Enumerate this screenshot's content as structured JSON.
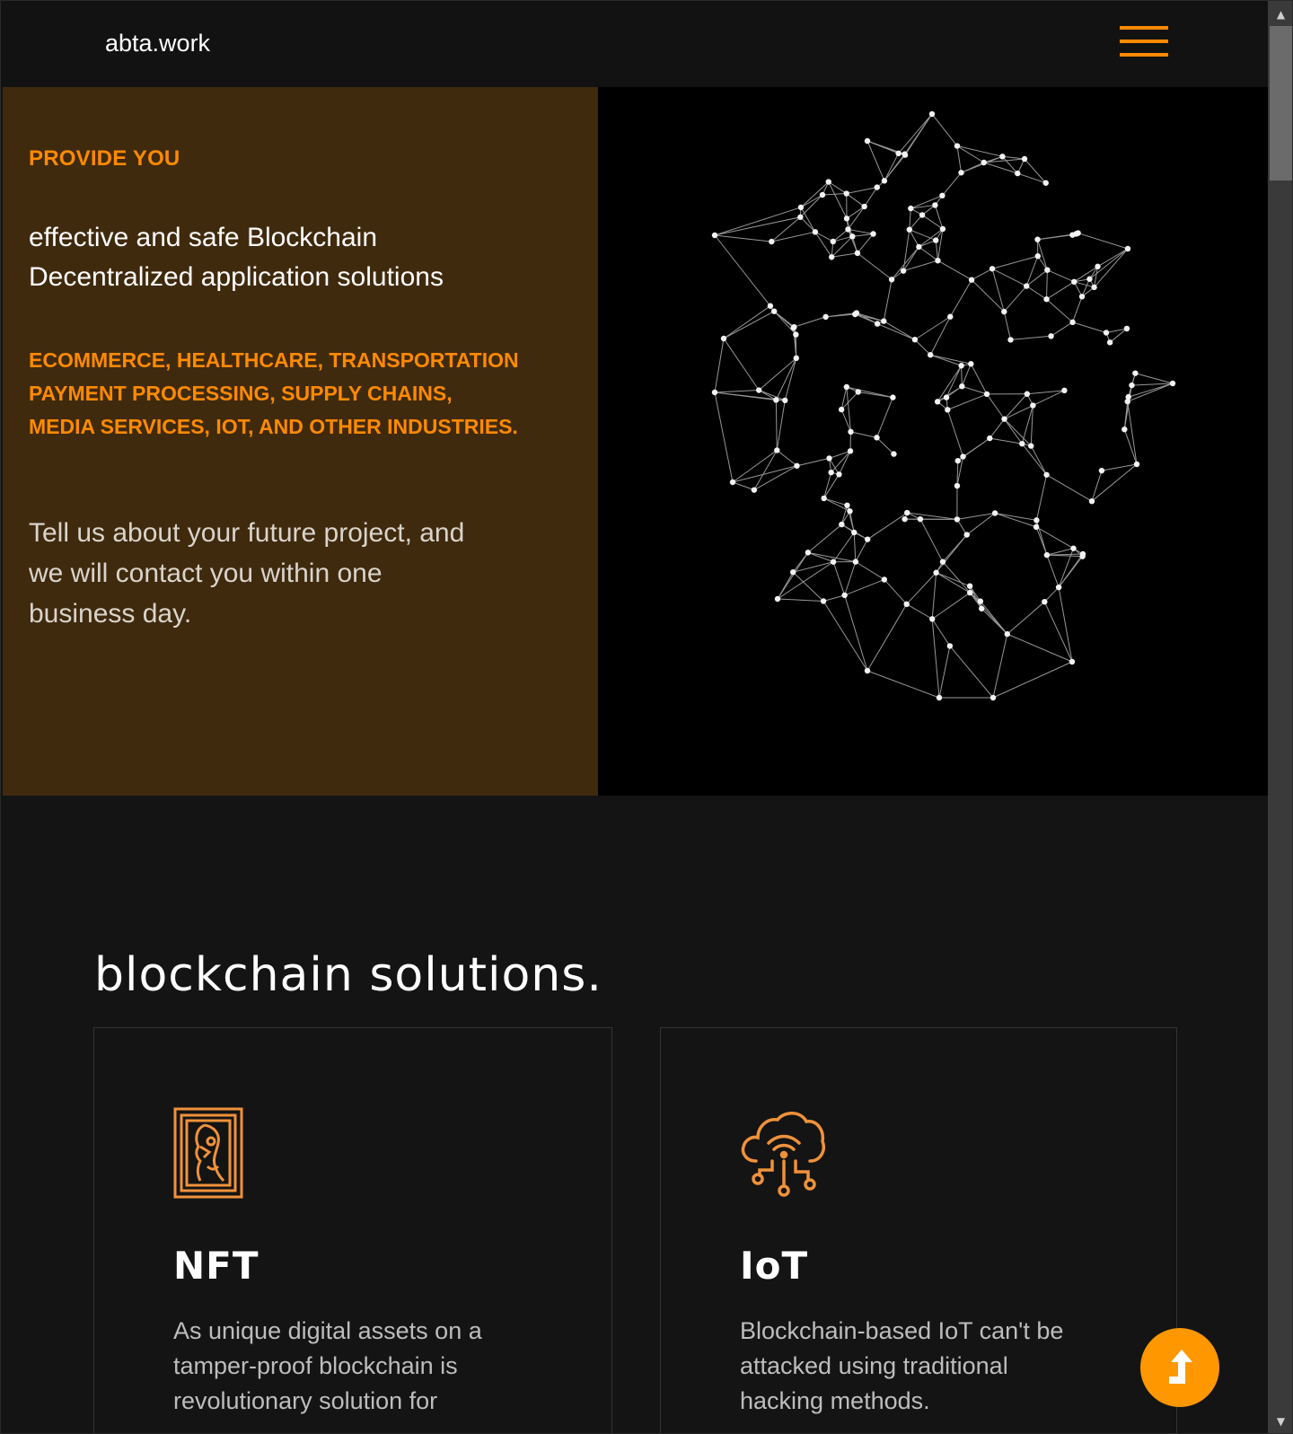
{
  "header": {
    "brand": "abta.work",
    "menu_icon": "hamburger-menu-icon",
    "accent": "#ff8a00"
  },
  "hero": {
    "eyebrow": "PROVIDE YOU",
    "heading_lines": [
      "effective and safe Blockchain",
      "Decentralized application solutions"
    ],
    "industries_lines": [
      "ECOMMERCE, HEALTHCARE, TRANSPORTATION",
      "PAYMENT PROCESSING, SUPPLY CHAINS,",
      "MEDIA SERVICES, IOT, AND OTHER INDUSTRIES."
    ],
    "contact_lines": [
      "Tell us about your future project, and",
      "we will contact you within one",
      "business day."
    ],
    "image": "network-mesh-illustration",
    "left_bg": "#402a0e"
  },
  "solutions": {
    "title": "blockchain solutions.",
    "cards": [
      {
        "icon": "nft-portrait-frame-icon",
        "title": "NFT",
        "text_lines": [
          "As unique digital assets on a",
          "tamper-proof blockchain is",
          "revolutionary solution for"
        ]
      },
      {
        "icon": "cloud-iot-icon",
        "title": "IoT",
        "text_lines": [
          "Blockchain-based IoT can't be",
          "attacked using traditional",
          "hacking methods."
        ]
      }
    ]
  },
  "scroll_top": {
    "icon": "arrow-up-icon",
    "color": "#ff9800"
  }
}
